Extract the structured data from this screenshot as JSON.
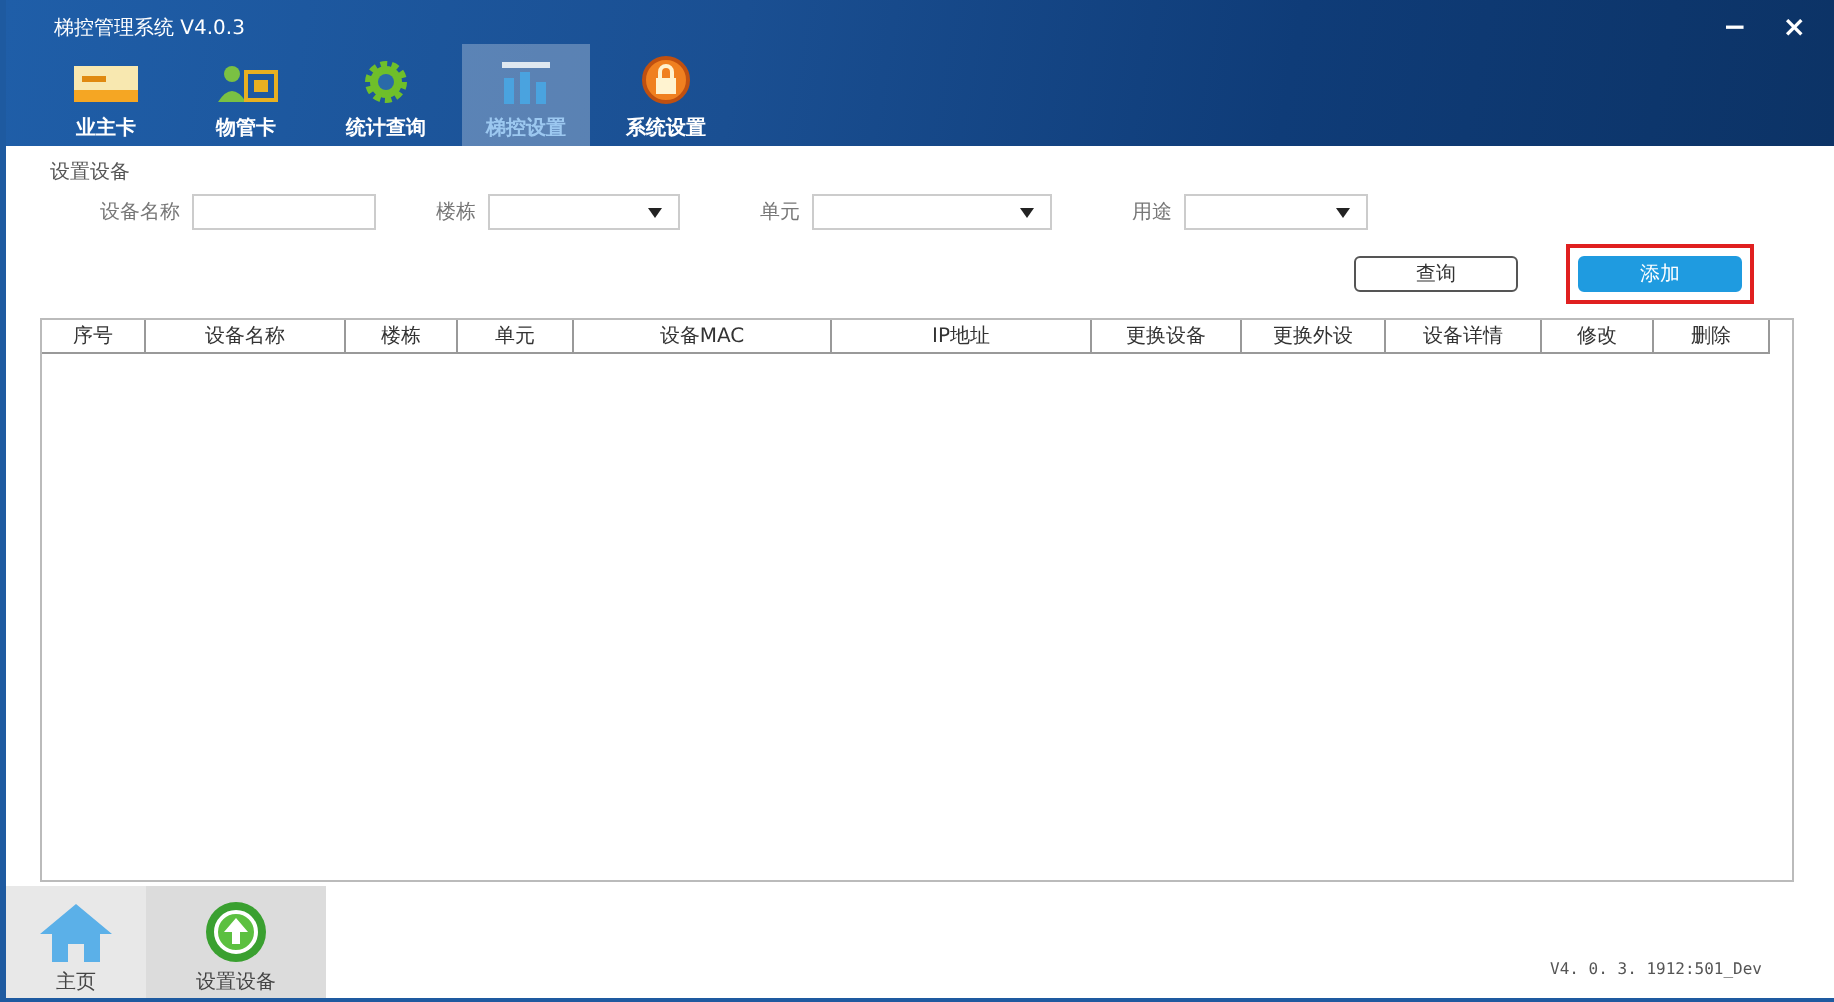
{
  "window": {
    "title": "梯控管理系统 V4.0.3",
    "controls": [
      "−",
      "×"
    ]
  },
  "tabs": [
    {
      "label": "业主卡",
      "kind": "card",
      "selected": false
    },
    {
      "label": "物管卡",
      "kind": "staff",
      "selected": false
    },
    {
      "label": "统计查询",
      "kind": "gear",
      "selected": false
    },
    {
      "label": "梯控设置",
      "kind": "elevator",
      "selected": true
    },
    {
      "label": "系统设置",
      "kind": "lock",
      "selected": false
    }
  ],
  "section_title": "设置设备",
  "filters": [
    {
      "label": "设备名称",
      "kind": "text"
    },
    {
      "label": "楼栋",
      "kind": "select"
    },
    {
      "label": "单元",
      "kind": "select"
    },
    {
      "label": "用途",
      "kind": "select"
    }
  ],
  "buttons": [
    {
      "label": "查询",
      "kind": "plain",
      "highlighted": false
    },
    {
      "label": "添加",
      "kind": "primary",
      "highlighted": true
    }
  ],
  "table": {
    "columns": [
      "序号",
      "设备名称",
      "楼栋",
      "单元",
      "设备MAC",
      "IP地址",
      "更换设备",
      "更换外设",
      "设备详情",
      "修改",
      "删除"
    ]
  },
  "bottom_nav": [
    {
      "label": "主页",
      "kind": "home",
      "selected": false
    },
    {
      "label": "设置设备",
      "kind": "up",
      "selected": true
    }
  ],
  "version": "V4. 0. 3. 1912:501_Dev"
}
